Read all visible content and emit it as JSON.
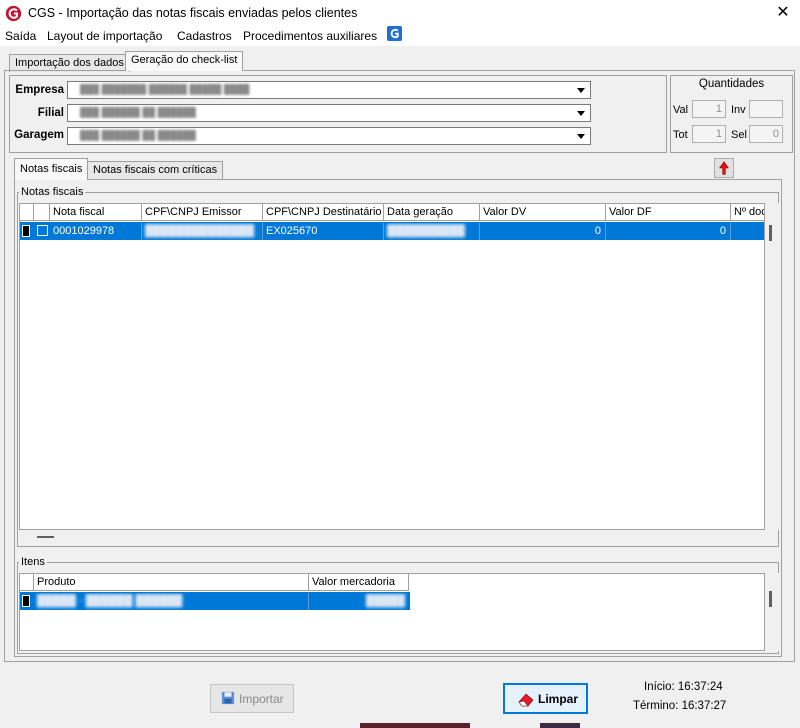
{
  "window": {
    "title": "CGS - Importação das notas fiscais enviadas pelos clientes"
  },
  "menu": {
    "items": [
      "Saída",
      "Layout de importação",
      "Cadastros",
      "Procedimentos auxiliares"
    ]
  },
  "top_tabs": [
    "Importação dos dados",
    "Geração do check-list"
  ],
  "filters": {
    "empresa_label": "Empresa",
    "filial_label": "Filial",
    "garagem_label": "Garagem"
  },
  "quantidades": {
    "title": "Quantidades",
    "val_label": "Val",
    "val_value": "1",
    "inv_label": "Inv",
    "inv_value": "",
    "tot_label": "Tot",
    "tot_value": "1",
    "sel_label": "Sel",
    "sel_value": "0"
  },
  "inner_tabs": [
    "Notas fiscais",
    "Notas fiscais com críticas"
  ],
  "notas_group": {
    "title": "Notas fiscais",
    "columns": [
      "Nota fiscal",
      "CPF\\CNPJ Emissor",
      "CPF\\CNPJ Destinatário",
      "Data geração",
      "Valor DV",
      "Valor DF",
      "Nº doc"
    ],
    "rows": [
      {
        "nota_fiscal": "0001029978",
        "destinatario": "EX025670",
        "valor_dv": "0",
        "valor_df": "0"
      }
    ]
  },
  "itens_group": {
    "title": "Itens",
    "columns": [
      "Produto",
      "Valor mercadoria"
    ]
  },
  "buttons": {
    "importar": "Importar",
    "limpar": "Limpar"
  },
  "status": {
    "inicio": "Início: 16:37:24",
    "termino": "Término: 16:37:27"
  },
  "colors": {
    "selection": "#0078d7",
    "brand_red": "#c8102e",
    "brand_blue": "#1f6fd1"
  }
}
